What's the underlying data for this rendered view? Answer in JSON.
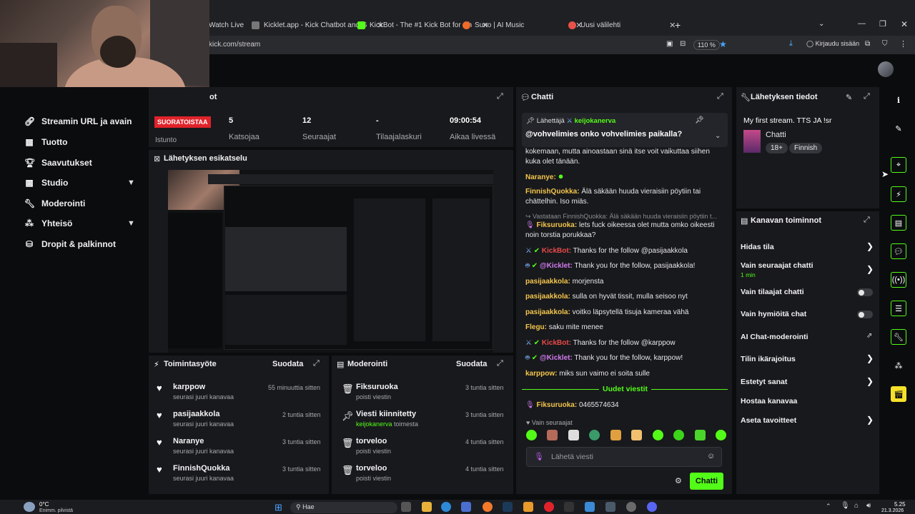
{
  "browser": {
    "tabs": [
      {
        "label": "Watch Live"
      },
      {
        "label": "Kicklet.app - Kick Chatbot and G"
      },
      {
        "label": "KickBot - The #1 Kick Bot for Ch"
      },
      {
        "label": "Suno | AI Music"
      },
      {
        "label": "Uusi välilehti"
      }
    ],
    "url": "kick.com/stream",
    "zoom": "110 %",
    "signin": "Kirjaudu sisään"
  },
  "sidebar": {
    "items": [
      {
        "label": "Streamin URL ja avain",
        "icon": "link-icon"
      },
      {
        "label": "Tuotto",
        "icon": "money-icon"
      },
      {
        "label": "Saavutukset",
        "icon": "trophy-icon"
      },
      {
        "label": "Studio",
        "icon": "studio-icon"
      },
      {
        "label": "Moderointi",
        "icon": "wrench-icon"
      },
      {
        "label": "Yhteisö",
        "icon": "community-icon"
      },
      {
        "label": "Dropit & palkinnot",
        "icon": "gift-icon"
      }
    ]
  },
  "stats": {
    "title_fragment": "ot",
    "live_badge": "SUORATOISTAA",
    "session_label": "Istunto",
    "viewers_value": "5",
    "viewers_label": "Katsojaa",
    "followers_value": "12",
    "followers_label": "Seuraajat",
    "subs_value": "-",
    "subs_label": "Tilaajalaskuri",
    "uptime_value": "09:00:54",
    "uptime_label": "Aikaa livessä"
  },
  "preview": {
    "title": "Lähetyksen esikatselu"
  },
  "activity": {
    "title": "Toimintasyöte",
    "filter": "Suodata",
    "rows": [
      {
        "name": "karppow",
        "sub": "seurasi juuri kanavaa",
        "time": "55 minuuttia sitten"
      },
      {
        "name": "pasijaakkola",
        "sub": "seurasi juuri kanavaa",
        "time": "2 tuntia sitten"
      },
      {
        "name": "Naranye",
        "sub": "seurasi juuri kanavaa",
        "time": "3 tuntia sitten"
      },
      {
        "name": "FinnishQuokka",
        "sub": "seurasi juuri kanavaa",
        "time": "3 tuntia sitten"
      }
    ]
  },
  "moderation": {
    "title": "Moderointi",
    "filter": "Suodata",
    "rows": [
      {
        "name": "Fiksuruoka",
        "sub": "poisti viestin",
        "time": "3 tuntia sitten"
      },
      {
        "name": "Viesti kiinnitetty",
        "sub_user": "keijokanerva",
        "sub": "toimesta",
        "time": "3 tuntia sitten"
      },
      {
        "name": "torveloo",
        "sub": "poisti viestin",
        "time": "4 tuntia sitten"
      },
      {
        "name": "torveloo",
        "sub": "poisti viestin",
        "time": "4 tuntia sitten"
      }
    ]
  },
  "chat": {
    "title": "Chatti",
    "pinned_by_label": "Lähettäjä",
    "pinned_by_user": "keijokanerva",
    "pinned_message": "@vohvelimies onko vohvelimies paikalla?",
    "messages": [
      {
        "user": "",
        "text": "kokemaan, mutta ainoastaan sinä itse voit vaikuttaa siihen kuka olet tänään."
      },
      {
        "user": "Naranye:",
        "text": ""
      },
      {
        "user": "FinnishQuokka:",
        "text": " Älä säkään huuda vieraisiin pöytiin tai chättelhin. Iso miäs."
      },
      {
        "user": "",
        "text": "Vastataan FinnishQuokka: Älä säkään huuda vieraisiin pöytiin t..."
      },
      {
        "user": "Fiksuruoka:",
        "text": " lets fuck oikeessa olet mutta omko oikeesti noin torstia porukkaa?"
      },
      {
        "user": "KickBot:",
        "text": " Thanks for the follow @pasijaakkola"
      },
      {
        "user": "@Kicklet:",
        "text": " Thank you for the follow, pasijaakkola!"
      },
      {
        "user": "pasijaakkola:",
        "text": " morjensta"
      },
      {
        "user": "pasijaakkola:",
        "text": " sulla on hyvät tissit, mulla seisoo nyt"
      },
      {
        "user": "pasijaakkola:",
        "text": " voitko läpsytellä tisuja kameraa vähä"
      },
      {
        "user": "Flegu:",
        "text": " saku mite menee"
      },
      {
        "user": "KickBot:",
        "text": " Thanks for the follow @karppow"
      },
      {
        "user": "@Kicklet:",
        "text": " Thank you for the follow, karppow!"
      },
      {
        "user": "karppow:",
        "text": " miks sun vaimo ei soita sulle"
      }
    ],
    "new_messages_label": "Uudet viestit",
    "new_message": {
      "user": "Fiksuruoka:",
      "text": " 0465574634"
    },
    "followers_only_label": "Vain seuraajat",
    "input_placeholder": "Lähetä viesti",
    "send_button": "Chatti"
  },
  "stream_info": {
    "title": "Lähetyksen tiedot",
    "stream_title": "My first stream. TTS JA !sr",
    "category": "Chatti",
    "age_badge": "18+",
    "language_badge": "Finnish"
  },
  "channel_actions": {
    "title": "Kanavan toiminnot",
    "rows": [
      {
        "label": "Hidas tila",
        "type": "chevron"
      },
      {
        "label": "Vain seuraajat chatti",
        "sub": "1 min",
        "type": "chevron"
      },
      {
        "label": "Vain tilaajat chatti",
        "type": "toggle"
      },
      {
        "label": "Vain hymiöitä chat",
        "type": "toggle"
      },
      {
        "label": "AI Chat-moderointi",
        "type": "external"
      },
      {
        "label": "Tilin ikärajoitus",
        "type": "chevron"
      },
      {
        "label": "Estetyt sanat",
        "type": "chevron"
      },
      {
        "label": "Hostaa kanavaa",
        "type": "none"
      },
      {
        "label": "Aseta tavoitteet",
        "type": "chevron"
      }
    ]
  },
  "taskbar": {
    "weather_temp": "0°C",
    "weather_desc": "Enimm. pilvistä",
    "search_placeholder": "Hae",
    "time": "5.25",
    "date": "21.3.2026"
  },
  "colors": {
    "accent": "#53fc18",
    "live": "#e0232b",
    "panel": "#18191c",
    "bg": "#0b0c0e"
  }
}
